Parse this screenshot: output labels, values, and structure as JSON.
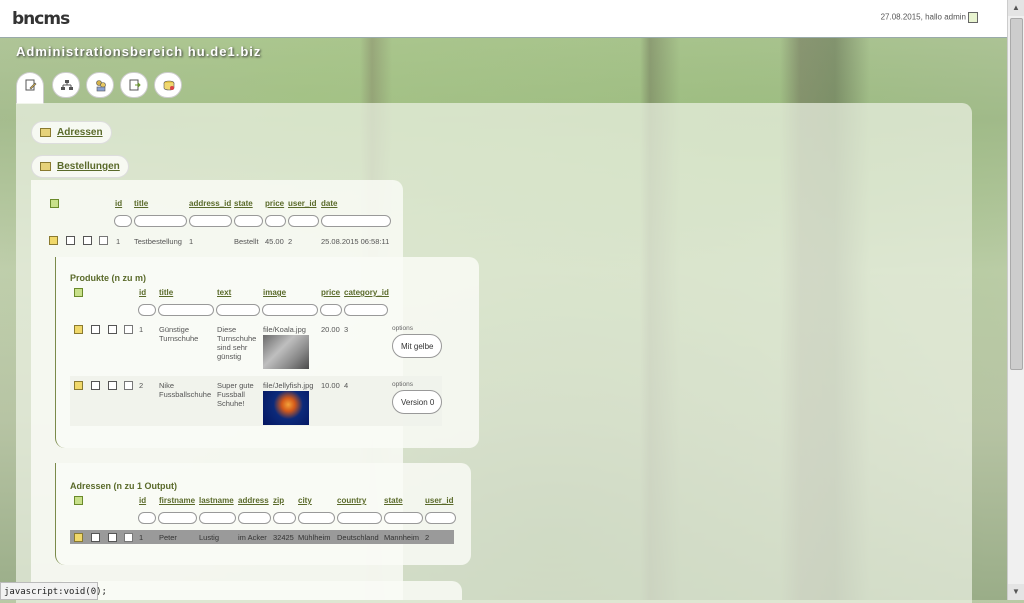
{
  "header": {
    "logo": "bncms",
    "user_info": "27.08.2015, hallo admin"
  },
  "title": "Administrationsbereich hu.de1.biz",
  "tabs": [
    {
      "icon": "document-icon"
    },
    {
      "icon": "sitemap-icon"
    },
    {
      "icon": "users-icon"
    },
    {
      "icon": "export-icon"
    },
    {
      "icon": "database-icon"
    }
  ],
  "sections": {
    "adressen": "Adressen",
    "bestellungen": "Bestellungen"
  },
  "bestellungen": {
    "columns": [
      "id",
      "title",
      "address_id",
      "state",
      "price",
      "user_id",
      "date"
    ],
    "row": {
      "id": "1",
      "title": "Testbestellung",
      "address_id": "1",
      "state": "Bestellt",
      "price": "45.00",
      "user_id": "2",
      "date": "25.08.2015 06:58:11"
    }
  },
  "produkte": {
    "heading": "Produkte (n zu m)",
    "columns": [
      "id",
      "title",
      "text",
      "image",
      "price",
      "category_id"
    ],
    "rows": [
      {
        "id": "1",
        "title": "Günstige Turnschuhe",
        "text": "Diese Turnschuhe sind sehr günstig",
        "image": "file/Koala.jpg",
        "price": "20.00",
        "category_id": "3",
        "options_label": "options",
        "option": "Mit gelbe"
      },
      {
        "id": "2",
        "title": "Nike Fussballschuhe",
        "text": "Super gute Fussball Schuhe!",
        "image": "file/Jellyfish.jpg",
        "price": "10.00",
        "category_id": "4",
        "options_label": "options",
        "option": "Version 0"
      }
    ]
  },
  "adressen_output": {
    "heading": "Adressen (n zu 1 Output)",
    "columns": [
      "id",
      "firstname",
      "lastname",
      "address",
      "zip",
      "city",
      "country",
      "state",
      "user_id"
    ],
    "row": {
      "id": "1",
      "firstname": "Peter",
      "lastname": "Lustig",
      "address": "im Acker",
      "zip": "32425",
      "city": "Mühlheim",
      "country": "Deutschland",
      "state": "Mannheim",
      "user_id": "2"
    }
  },
  "statusbar": "javascript:void(0);"
}
